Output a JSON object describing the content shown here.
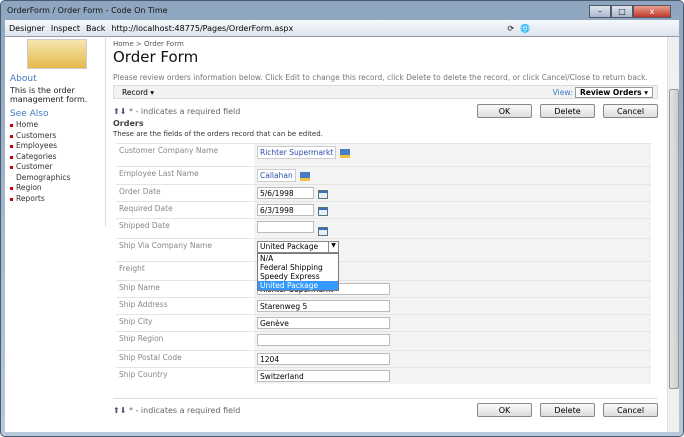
{
  "window": {
    "title": "OrderForm / Order Form - Code On Time"
  },
  "toolbar": {
    "designer": "Designer",
    "inspect": "Inspect",
    "back": "Back",
    "url": "http://localhost:48775/Pages/OrderForm.aspx"
  },
  "sidebar": {
    "about_title": "About",
    "about_text": "This is the order management form.",
    "see_also": "See Also",
    "links": [
      "Home",
      "Customers",
      "Employees",
      "Categories",
      "Customer Demographics",
      "Region",
      "Reports"
    ]
  },
  "breadcrumb": {
    "home": "Home",
    "sep": ">",
    "current": "Order Form"
  },
  "page_title": "Order Form",
  "description": "Please review orders information below. Click Edit to change this record, click Delete to delete the record, or click Cancel/Close to return back.",
  "actionbar": {
    "record": "Record ▾",
    "view_label": "View:",
    "view_value": "Review Orders ▾"
  },
  "required_note": "* - indicates a required field",
  "buttons": {
    "ok": "OK",
    "delete": "Delete",
    "cancel": "Cancel"
  },
  "form": {
    "title": "Orders",
    "subtitle": "These are the fields of the orders record that can be edited.",
    "fields": [
      {
        "label": "Customer Company Name",
        "value": "Richter Supermarkt"
      },
      {
        "label": "Employee Last Name",
        "value": "Callahan"
      },
      {
        "label": "Order Date",
        "value": "5/6/1998"
      },
      {
        "label": "Required Date",
        "value": "6/3/1998"
      },
      {
        "label": "Shipped Date",
        "value": ""
      },
      {
        "label": "Ship Via Company Name",
        "value": "United Package"
      },
      {
        "label": "Freight",
        "value": ""
      },
      {
        "label": "Ship Name",
        "value": "Richter Supermarkt"
      },
      {
        "label": "Ship Address",
        "value": "Starenweg 5"
      },
      {
        "label": "Ship City",
        "value": "Genève"
      },
      {
        "label": "Ship Region",
        "value": ""
      },
      {
        "label": "Ship Postal Code",
        "value": "1204"
      },
      {
        "label": "Ship Country",
        "value": "Switzerland"
      }
    ],
    "ship_via_options": [
      "N/A",
      "Federal Shipping",
      "Speedy Express",
      "United Package"
    ]
  }
}
